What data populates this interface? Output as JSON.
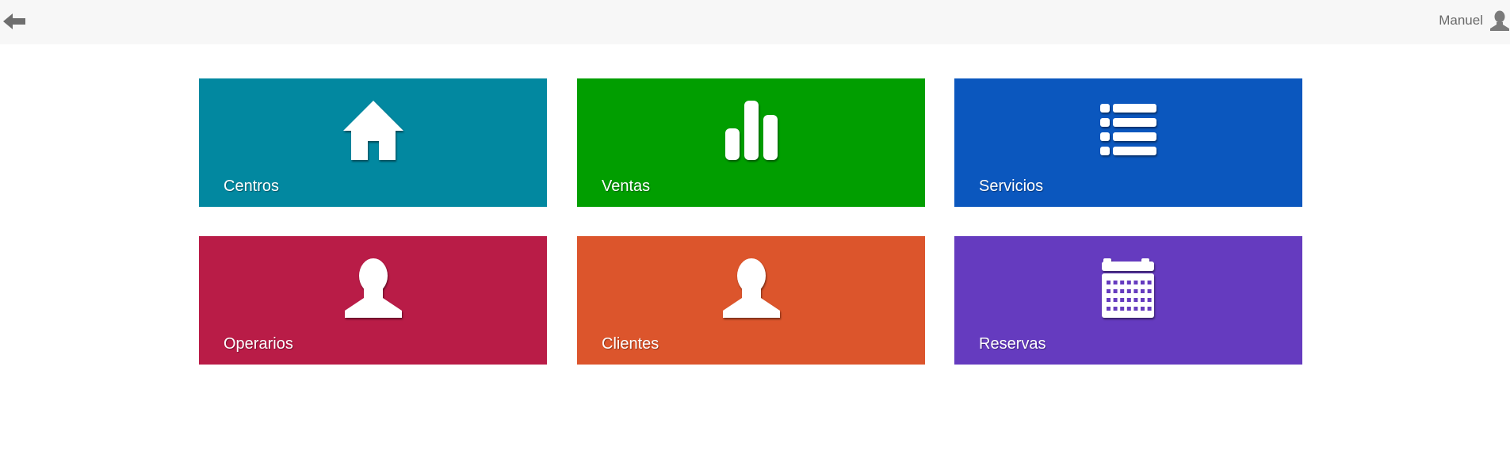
{
  "header": {
    "back_icon": "arrow-left-icon",
    "user_name": "Manuel",
    "user_icon": "user-icon"
  },
  "tiles": [
    {
      "label": "Centros",
      "icon": "home-icon",
      "color": "#0288a0"
    },
    {
      "label": "Ventas",
      "icon": "bar-chart-icon",
      "color": "#019e00"
    },
    {
      "label": "Servicios",
      "icon": "list-icon",
      "color": "#0b57be"
    },
    {
      "label": "Operarios",
      "icon": "user-icon",
      "color": "#b91c47"
    },
    {
      "label": "Clientes",
      "icon": "user-icon",
      "color": "#dc552c"
    },
    {
      "label": "Reservas",
      "icon": "calendar-icon",
      "color": "#653bbf"
    }
  ]
}
